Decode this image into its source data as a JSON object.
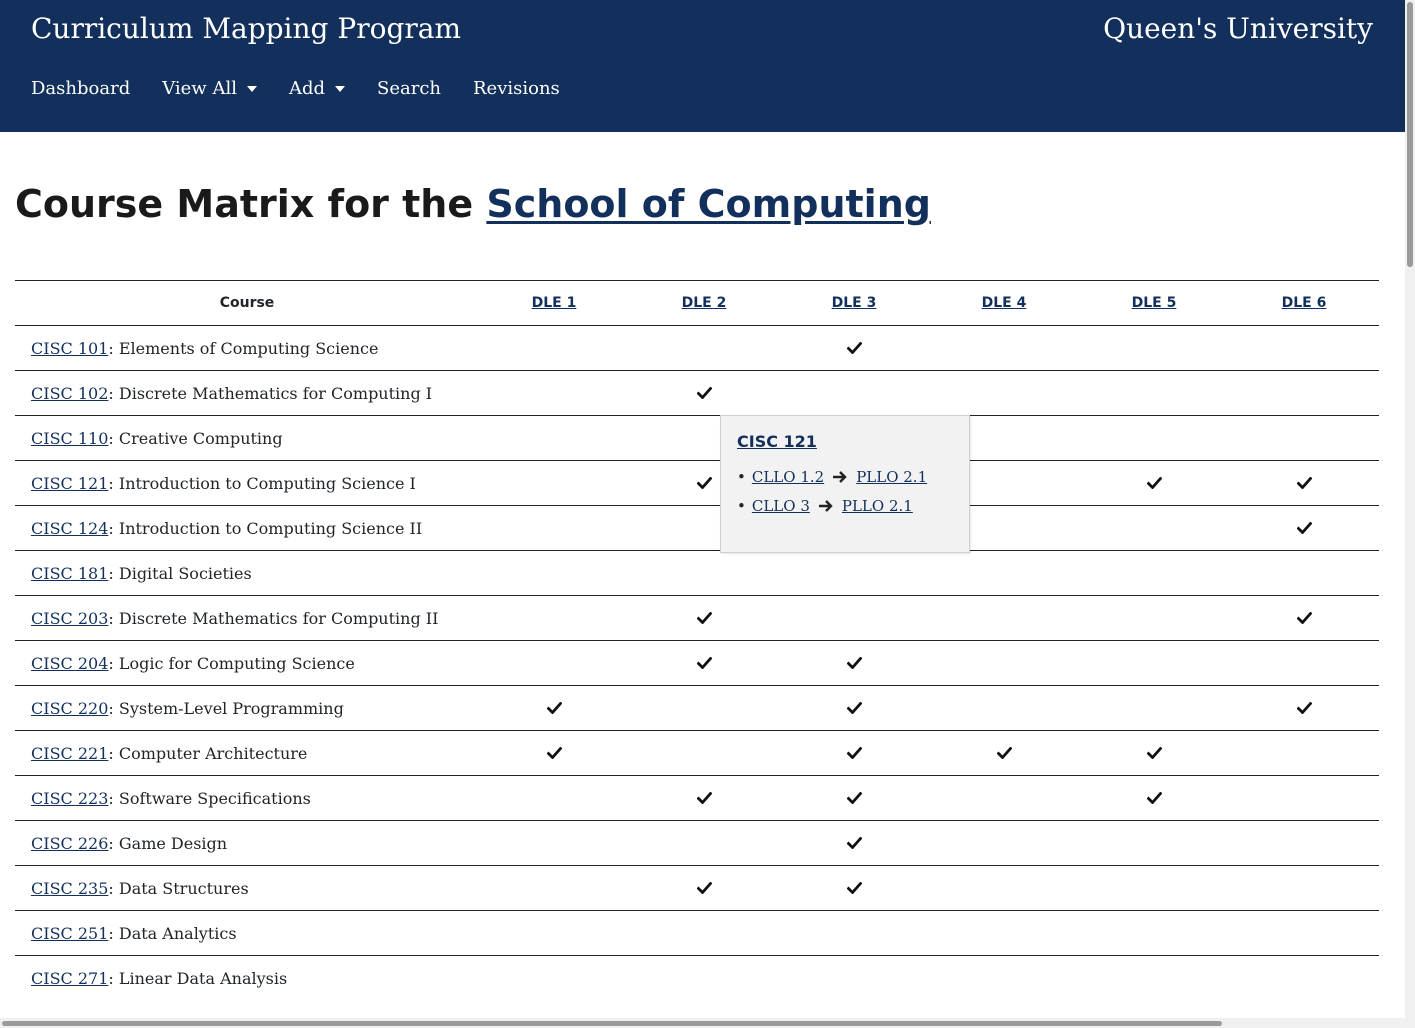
{
  "header": {
    "app_title": "Curriculum Mapping Program",
    "brand": "Queen's University",
    "nav": [
      {
        "label": "Dashboard",
        "dropdown": false
      },
      {
        "label": "View All",
        "dropdown": true
      },
      {
        "label": "Add",
        "dropdown": true
      },
      {
        "label": "Search",
        "dropdown": false
      },
      {
        "label": "Revisions",
        "dropdown": false
      }
    ]
  },
  "page": {
    "title_prefix": "Course Matrix for the ",
    "title_link": "School of Computing"
  },
  "table": {
    "course_header": "Course",
    "dle_headers": [
      "DLE 1",
      "DLE 2",
      "DLE 3",
      "DLE 4",
      "DLE 5",
      "DLE 6"
    ],
    "rows": [
      {
        "code": "CISC 101",
        "name": ": Elements of Computing Science",
        "checks": [
          0,
          0,
          1,
          0,
          0,
          0
        ]
      },
      {
        "code": "CISC 102",
        "name": ": Discrete Mathematics for Computing I",
        "checks": [
          0,
          1,
          0,
          0,
          0,
          0
        ]
      },
      {
        "code": "CISC 110",
        "name": ": Creative Computing",
        "checks": [
          0,
          0,
          0,
          0,
          0,
          0
        ]
      },
      {
        "code": "CISC 121",
        "name": ": Introduction to Computing Science I",
        "checks": [
          0,
          1,
          0,
          0,
          1,
          1
        ]
      },
      {
        "code": "CISC 124",
        "name": ": Introduction to Computing Science II",
        "checks": [
          0,
          0,
          0,
          0,
          0,
          1
        ]
      },
      {
        "code": "CISC 181",
        "name": ": Digital Societies",
        "checks": [
          0,
          0,
          0,
          0,
          0,
          0
        ]
      },
      {
        "code": "CISC 203",
        "name": ": Discrete Mathematics for Computing II",
        "checks": [
          0,
          1,
          0,
          0,
          0,
          1
        ]
      },
      {
        "code": "CISC 204",
        "name": ": Logic for Computing Science",
        "checks": [
          0,
          1,
          1,
          0,
          0,
          0
        ]
      },
      {
        "code": "CISC 220",
        "name": ": System-Level Programming",
        "checks": [
          1,
          0,
          1,
          0,
          0,
          1
        ]
      },
      {
        "code": "CISC 221",
        "name": ": Computer Architecture",
        "checks": [
          1,
          0,
          1,
          1,
          1,
          0
        ]
      },
      {
        "code": "CISC 223",
        "name": ": Software Specifications",
        "checks": [
          0,
          1,
          1,
          0,
          1,
          0
        ]
      },
      {
        "code": "CISC 226",
        "name": ": Game Design",
        "checks": [
          0,
          0,
          1,
          0,
          0,
          0
        ]
      },
      {
        "code": "CISC 235",
        "name": ": Data Structures",
        "checks": [
          0,
          1,
          1,
          0,
          0,
          0
        ]
      },
      {
        "code": "CISC 251",
        "name": ": Data Analytics",
        "checks": [
          0,
          0,
          0,
          0,
          0,
          0
        ]
      },
      {
        "code": "CISC 271",
        "name": ": Linear Data Analysis",
        "checks": [
          0,
          0,
          0,
          0,
          0,
          0
        ]
      }
    ]
  },
  "popover": {
    "title": "CISC 121",
    "items": [
      {
        "from": "CLLO 1.2",
        "to": "PLLO 2.1"
      },
      {
        "from": "CLLO 3",
        "to": "PLLO 2.1"
      }
    ]
  },
  "colors": {
    "header_bg": "#12305b",
    "link": "#12305b",
    "popover_bg": "#f2f2f2"
  }
}
